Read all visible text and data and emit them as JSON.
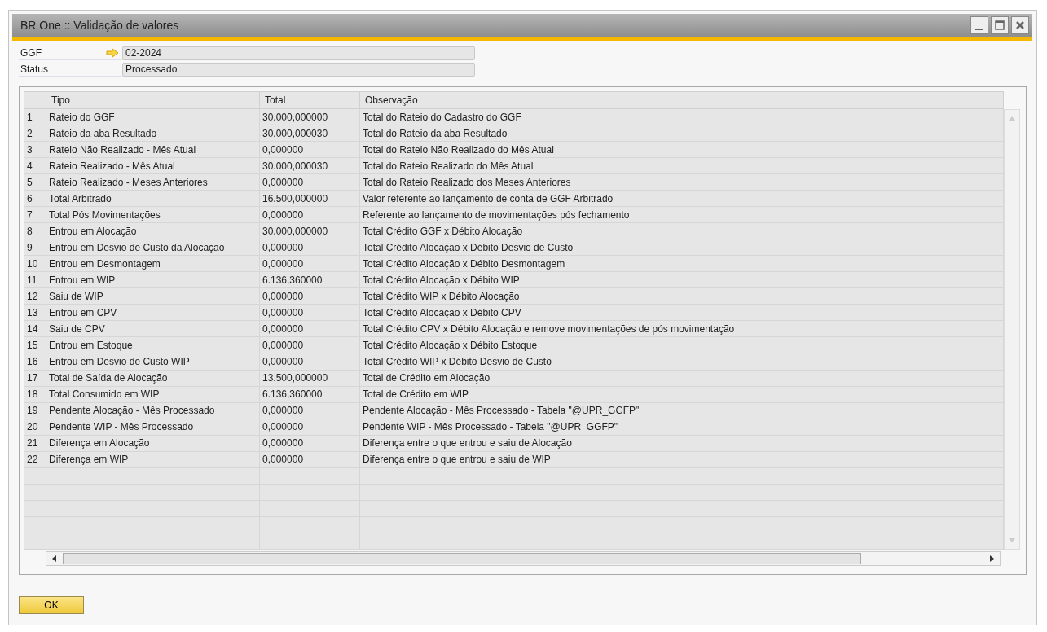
{
  "window": {
    "title": "BR One :: Validação de valores"
  },
  "fields": [
    {
      "label": "GGF",
      "value": "02-2024",
      "linked": true
    },
    {
      "label": "Status",
      "value": "Processado",
      "linked": false
    }
  ],
  "table": {
    "columns": [
      "Tipo",
      "Total",
      "Observação"
    ],
    "rows": [
      {
        "number": "1",
        "tipo": "Rateio do GGF",
        "total": "30.000,000000",
        "observacao": "Total do Rateio do Cadastro do GGF"
      },
      {
        "number": "2",
        "tipo": "Rateio da aba Resultado",
        "total": "30.000,000030",
        "observacao": "Total do Rateio da aba Resultado"
      },
      {
        "number": "3",
        "tipo": "Rateio Não Realizado - Mês Atual",
        "total": "0,000000",
        "observacao": "Total do Rateio Não Realizado do Mês Atual"
      },
      {
        "number": "4",
        "tipo": "Rateio Realizado - Mês Atual",
        "total": "30.000,000030",
        "observacao": "Total do Rateio Realizado do Mês Atual"
      },
      {
        "number": "5",
        "tipo": "Rateio Realizado - Meses Anteriores",
        "total": "0,000000",
        "observacao": "Total do Rateio Realizado dos Meses Anteriores"
      },
      {
        "number": "6",
        "tipo": "Total Arbitrado",
        "total": "16.500,000000",
        "observacao": "Valor referente ao lançamento de conta de GGF Arbitrado"
      },
      {
        "number": "7",
        "tipo": "Total Pós Movimentações",
        "total": "0,000000",
        "observacao": "Referente ao lançamento de movimentações pós fechamento"
      },
      {
        "number": "8",
        "tipo": "Entrou em Alocação",
        "total": "30.000,000000",
        "observacao": "Total Crédito GGF x Débito Alocação"
      },
      {
        "number": "9",
        "tipo": "Entrou em Desvio de Custo da Alocação",
        "total": "0,000000",
        "observacao": "Total Crédito Alocação x Débito Desvio de Custo"
      },
      {
        "number": "10",
        "tipo": "Entrou em Desmontagem",
        "total": "0,000000",
        "observacao": "Total Crédito Alocação x Débito Desmontagem"
      },
      {
        "number": "11",
        "tipo": "Entrou em WIP",
        "total": "6.136,360000",
        "observacao": "Total Crédito Alocação x Débito WIP"
      },
      {
        "number": "12",
        "tipo": "Saiu de WIP",
        "total": "0,000000",
        "observacao": "Total Crédito WIP x Débito Alocação"
      },
      {
        "number": "13",
        "tipo": "Entrou em CPV",
        "total": "0,000000",
        "observacao": "Total Crédito Alocação x Débito CPV"
      },
      {
        "number": "14",
        "tipo": "Saiu de CPV",
        "total": "0,000000",
        "observacao": "Total Crédito CPV x Débito Alocação e remove movimentações de pós movimentação"
      },
      {
        "number": "15",
        "tipo": "Entrou em Estoque",
        "total": "0,000000",
        "observacao": "Total Crédito Alocação x Débito Estoque"
      },
      {
        "number": "16",
        "tipo": "Entrou em Desvio de Custo WIP",
        "total": "0,000000",
        "observacao": "Total Crédito WIP x Débito Desvio de Custo"
      },
      {
        "number": "17",
        "tipo": "Total de Saída de Alocação",
        "total": "13.500,000000",
        "observacao": "Total de Crédito em Alocação"
      },
      {
        "number": "18",
        "tipo": "Total Consumido em WIP",
        "total": "6.136,360000",
        "observacao": "Total de Crédito em WIP"
      },
      {
        "number": "19",
        "tipo": "Pendente Alocação - Mês Processado",
        "total": "0,000000",
        "observacao": "Pendente Alocação - Mês Processado - Tabela \"@UPR_GGFP\""
      },
      {
        "number": "20",
        "tipo": "Pendente WIP - Mês Processado",
        "total": "0,000000",
        "observacao": "Pendente WIP - Mês Processado - Tabela \"@UPR_GGFP\""
      },
      {
        "number": "21",
        "tipo": "Diferença em Alocação",
        "total": "0,000000",
        "observacao": "Diferença entre o que entrou e saiu de Alocação"
      },
      {
        "number": "22",
        "tipo": "Diferença em WIP",
        "total": "0,000000",
        "observacao": "Diferença entre o que entrou e saiu de WIP"
      }
    ]
  },
  "buttons": [
    "OK"
  ]
}
